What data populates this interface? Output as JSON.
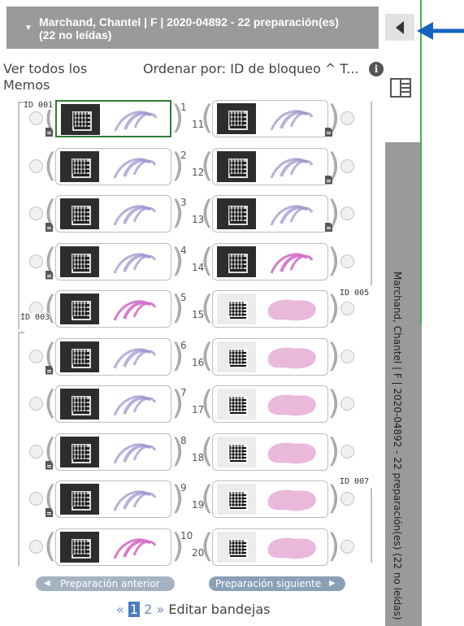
{
  "header": {
    "title": "Marchand, Chantel | F | 2020-04892 - 22 preparación(es) (22 no leídas)"
  },
  "controls": {
    "view_all": "Ver todos los Memos",
    "sort_label": "Ordenar por:",
    "sort_value": "ID de bloqueo",
    "sort_trunc": "^ T...",
    "info": "i"
  },
  "blocks": [
    "ID 001",
    "ID 003",
    "ID 005",
    "ID 007"
  ],
  "slides_left": [
    {
      "n": "1",
      "stain": "purple",
      "selected": true
    },
    {
      "n": "2",
      "stain": "purple"
    },
    {
      "n": "3",
      "stain": "purple"
    },
    {
      "n": "4",
      "stain": "purple"
    },
    {
      "n": "5",
      "stain": "pink"
    },
    {
      "n": "6",
      "stain": "purple"
    },
    {
      "n": "7",
      "stain": "purple"
    },
    {
      "n": "8",
      "stain": "purple"
    },
    {
      "n": "9",
      "stain": "purple"
    },
    {
      "n": "10",
      "stain": "pink"
    }
  ],
  "slides_right": [
    {
      "n": "11",
      "stain": "purple"
    },
    {
      "n": "12",
      "stain": "purple"
    },
    {
      "n": "13",
      "stain": "purple"
    },
    {
      "n": "14",
      "stain": "pink"
    },
    {
      "n": "15",
      "stain": "he"
    },
    {
      "n": "16",
      "stain": "he"
    },
    {
      "n": "17",
      "stain": "he"
    },
    {
      "n": "18",
      "stain": "he"
    },
    {
      "n": "19",
      "stain": "he"
    },
    {
      "n": "20",
      "stain": "he"
    }
  ],
  "nav": {
    "prev": "Preparación anterior",
    "next": "Preparación siguiente"
  },
  "pager": {
    "prev": "«",
    "pages": [
      "1",
      "2"
    ],
    "next": "»",
    "edit": "Editar bandejas"
  },
  "side": {
    "vertical_title": "Marchand, Chantel | F | 2020-04892 - 22 preparación(es) (22 no leídas)"
  },
  "colors": {
    "header_bg": "#9a9a9a",
    "selected": "#2e7d32",
    "nav_button": "#8aa0b6",
    "arrow": "#1565c0"
  }
}
